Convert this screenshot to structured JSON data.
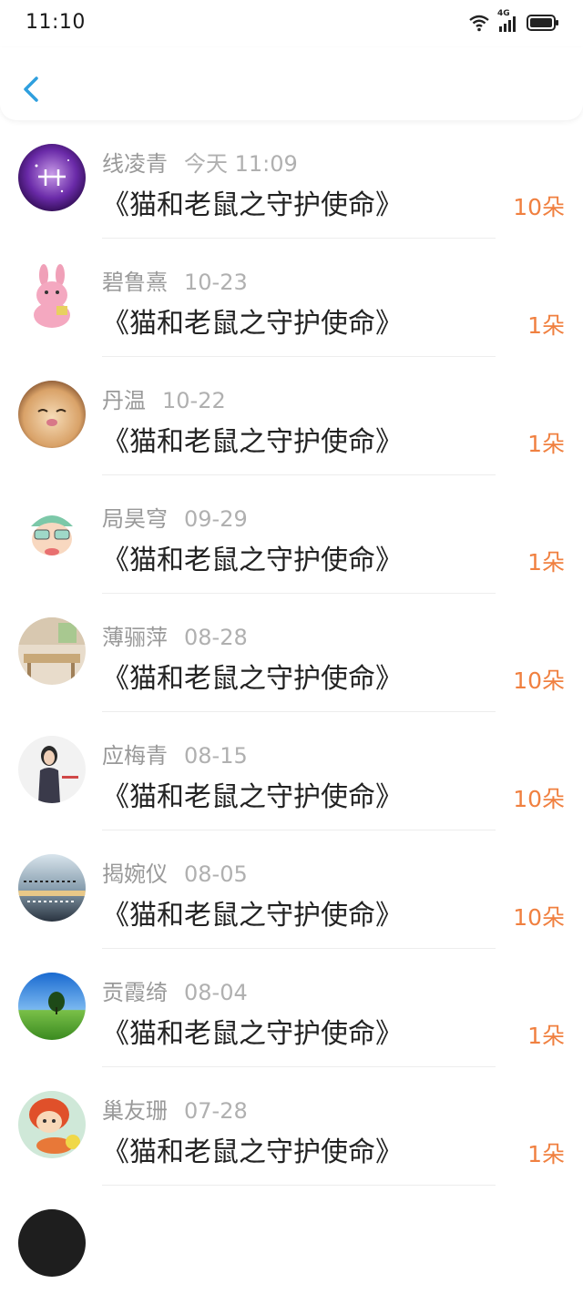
{
  "status_bar": {
    "time": "11:10",
    "network": "4G"
  },
  "header": {
    "back_icon": "chevron-left-icon"
  },
  "colors": {
    "accent": "#2f9fde",
    "count": "#f08040",
    "name": "#999999",
    "title": "#222222"
  },
  "items": [
    {
      "name": "线凌青",
      "date": "今天 11:09",
      "title": "《猫和老鼠之守护使命》",
      "count": "10朵"
    },
    {
      "name": "碧鲁熹",
      "date": "10-23",
      "title": "《猫和老鼠之守护使命》",
      "count": "1朵"
    },
    {
      "name": "丹温",
      "date": "10-22",
      "title": "《猫和老鼠之守护使命》",
      "count": "1朵"
    },
    {
      "name": "局昊穹",
      "date": "09-29",
      "title": "《猫和老鼠之守护使命》",
      "count": "1朵"
    },
    {
      "name": "薄骊萍",
      "date": "08-28",
      "title": "《猫和老鼠之守护使命》",
      "count": "10朵"
    },
    {
      "name": "应梅青",
      "date": "08-15",
      "title": "《猫和老鼠之守护使命》",
      "count": "10朵"
    },
    {
      "name": "揭婉仪",
      "date": "08-05",
      "title": "《猫和老鼠之守护使命》",
      "count": "10朵"
    },
    {
      "name": "贡霞绮",
      "date": "08-04",
      "title": "《猫和老鼠之守护使命》",
      "count": "1朵"
    },
    {
      "name": "巢友珊",
      "date": "07-28",
      "title": "《猫和老鼠之守护使命》",
      "count": "1朵"
    }
  ]
}
